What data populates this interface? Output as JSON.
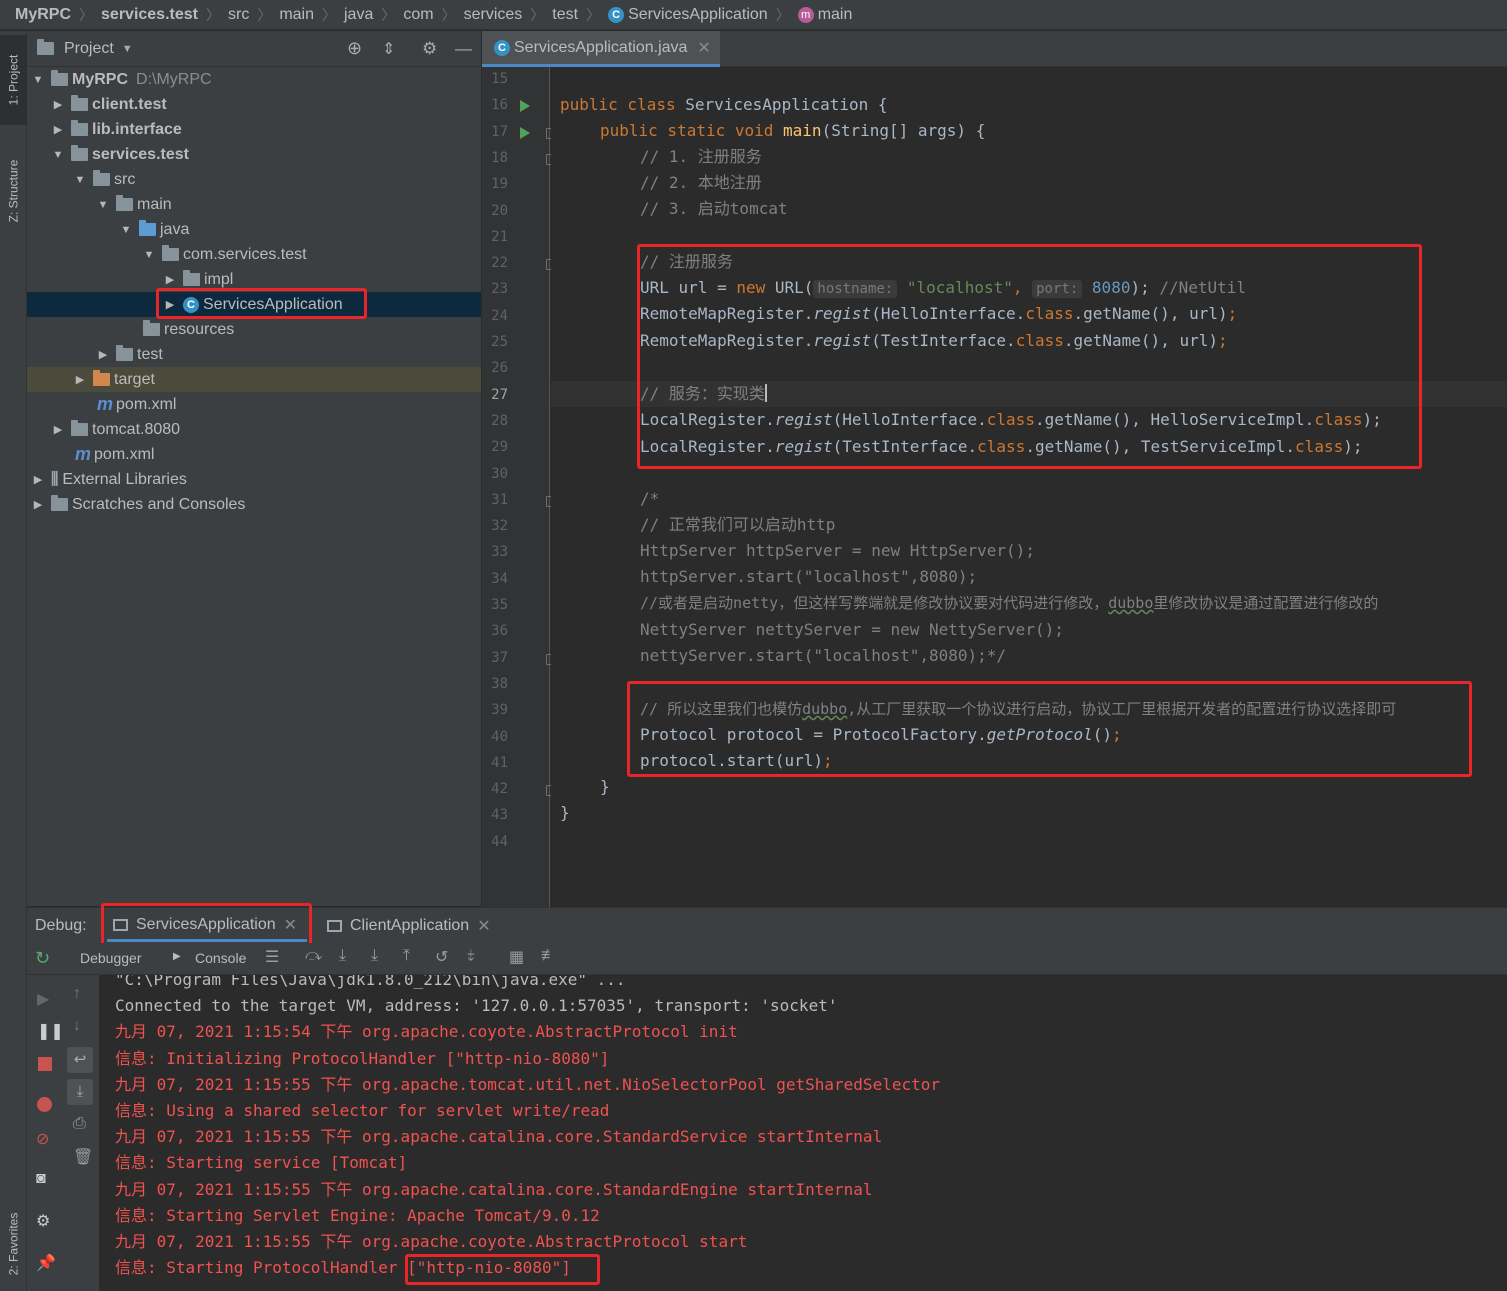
{
  "navbar": {
    "crumbs": [
      "MyRPC",
      "services.test",
      "src",
      "main",
      "java",
      "com",
      "services",
      "test",
      "ServicesApplication",
      "main"
    ],
    "separator": "〉",
    "class_icon_letter": "C",
    "method_icon_letter": "m"
  },
  "left_strip": {
    "project_tab": "1: Project",
    "structure_tab": "Z: Structure",
    "favorites_tab": "2: Favorites"
  },
  "project": {
    "title": "Project",
    "tree": [
      {
        "label": "MyRPC",
        "path": "D:\\MyRPC"
      },
      {
        "label": "client.test"
      },
      {
        "label": "lib.interface"
      },
      {
        "label": "services.test"
      },
      {
        "label": "src"
      },
      {
        "label": "main"
      },
      {
        "label": "java"
      },
      {
        "label": "com.services.test"
      },
      {
        "label": "impl"
      },
      {
        "label": "ServicesApplication"
      },
      {
        "label": "resources"
      },
      {
        "label": "test"
      },
      {
        "label": "target"
      },
      {
        "label": "pom.xml"
      },
      {
        "label": "tomcat.8080"
      },
      {
        "label": "pom.xml"
      },
      {
        "label": "External Libraries"
      },
      {
        "label": "Scratches and Consoles"
      }
    ],
    "maven_letter": "m"
  },
  "editor": {
    "tab": "ServicesApplication.java",
    "line_numbers": [
      "15",
      "16",
      "17",
      "18",
      "19",
      "20",
      "21",
      "22",
      "23",
      "24",
      "25",
      "26",
      "27",
      "28",
      "29",
      "30",
      "31",
      "32",
      "33",
      "34",
      "35",
      "36",
      "37",
      "38",
      "39",
      "40",
      "41",
      "42",
      "43",
      "44"
    ],
    "current_line": "27",
    "code": {
      "l16_a": "public class ",
      "l16_b": "ServicesApplication {",
      "l17_a": "public static void ",
      "l17_b": "main",
      "l17_c": "(String[] args) {",
      "l18": "// 1. 注册服务",
      "l19": "// 2. 本地注册",
      "l20": "// 3. 启动tomcat",
      "l22": "// 注册服务",
      "l23_a": "URL url = ",
      "l23_b": "new ",
      "l23_c": "URL(",
      "l23_hint1": "hostname:",
      "l23_d": "\"localhost\"",
      "l23_e": ", ",
      "l23_hint2": "port:",
      "l23_f": "8080",
      "l23_g": "); ",
      "l23_h": "//NetUtil",
      "l24_a": "RemoteMapRegister.",
      "l24_b": "regist",
      "l24_c": "(HelloInterface.",
      "l24_d": "class",
      "l24_e": ".getName(), url)",
      "l24_f": ";",
      "l25_a": "RemoteMapRegister.",
      "l25_b": "regist",
      "l25_c": "(TestInterface.",
      "l25_d": "class",
      "l25_e": ".getName(), url)",
      "l25_f": ";",
      "l27": "// 服务：实现类",
      "l28_a": "LocalRegister.",
      "l28_b": "regist",
      "l28_c": "(HelloInterface.",
      "l28_d": "class",
      "l28_e": ".getName(), HelloServiceImpl.",
      "l28_f": "class",
      "l28_g": ");",
      "l29_a": "LocalRegister.",
      "l29_b": "regist",
      "l29_c": "(TestInterface.",
      "l29_d": "class",
      "l29_e": ".getName(), TestServiceImpl.",
      "l29_f": "class",
      "l29_g": ");",
      "l31": "/*",
      "l32": "// 正常我们可以启动http",
      "l33": "HttpServer httpServer = new HttpServer();",
      "l34": "httpServer.start(\"localhost\",8080);",
      "l35_a": "//或者是启动netty，但这样写弊端就是修改协议要对代码进行修改，",
      "l35_b": "dubbo",
      "l35_c": "里修改协议是通过配置进行修改的",
      "l36": "NettyServer nettyServer = new NettyServer();",
      "l37": "nettyServer.start(\"localhost\",8080);*/",
      "l39_a": "// 所以这里我们也模仿",
      "l39_b": "dubbo",
      "l39_c": ",从工厂里获取一个协议进行启动，协议工厂里根据开发者的配置进行协议选择即可",
      "l40_a": "Protocol protocol = ProtocolFactory.",
      "l40_b": "getProtocol",
      "l40_c": "()",
      "l40_d": ";",
      "l41_a": "protocol.start(url)",
      "l41_b": ";",
      "l42": "}",
      "l43": "}"
    }
  },
  "debug": {
    "label": "Debug:",
    "tabs": [
      "ServicesApplication",
      "ClientApplication"
    ],
    "subtabs": {
      "debugger": "Debugger",
      "console": "Console"
    },
    "console_lines": [
      {
        "text": "\"C:\\Program Files\\Java\\jdk1.8.0_212\\bin\\java.exe\" ...",
        "color": "#bbbbbb"
      },
      {
        "text": "Connected to the target VM, address: '127.0.0.1:57035', transport: 'socket'",
        "color": "#bbbbbb"
      },
      {
        "text": "九月 07, 2021 1:15:54 下午 org.apache.coyote.AbstractProtocol init",
        "color": "#f0524f"
      },
      {
        "text": "信息: Initializing ProtocolHandler [\"http-nio-8080\"]",
        "color": "#f0524f"
      },
      {
        "text": "九月 07, 2021 1:15:55 下午 org.apache.tomcat.util.net.NioSelectorPool getSharedSelector",
        "color": "#f0524f"
      },
      {
        "text": "信息: Using a shared selector for servlet write/read",
        "color": "#f0524f"
      },
      {
        "text": "九月 07, 2021 1:15:55 下午 org.apache.catalina.core.StandardService startInternal",
        "color": "#f0524f"
      },
      {
        "text": "信息: Starting service [Tomcat]",
        "color": "#f0524f"
      },
      {
        "text": "九月 07, 2021 1:15:55 下午 org.apache.catalina.core.StandardEngine startInternal",
        "color": "#f0524f"
      },
      {
        "text": "信息: Starting Servlet Engine: Apache Tomcat/9.0.12",
        "color": "#f0524f"
      },
      {
        "text": "九月 07, 2021 1:15:55 下午 org.apache.coyote.AbstractProtocol start",
        "color": "#f0524f"
      },
      {
        "text": "信息: Starting ProtocolHandler [\"http-nio-8080\"]",
        "color": "#f0524f"
      }
    ]
  },
  "colors": {
    "annotation_red": "#e8262a",
    "keyword": "#cc7832",
    "string": "#6a8759",
    "number": "#6897bb",
    "comment": "#808080",
    "method": "#ffc66d",
    "selection": "#0d293e"
  }
}
